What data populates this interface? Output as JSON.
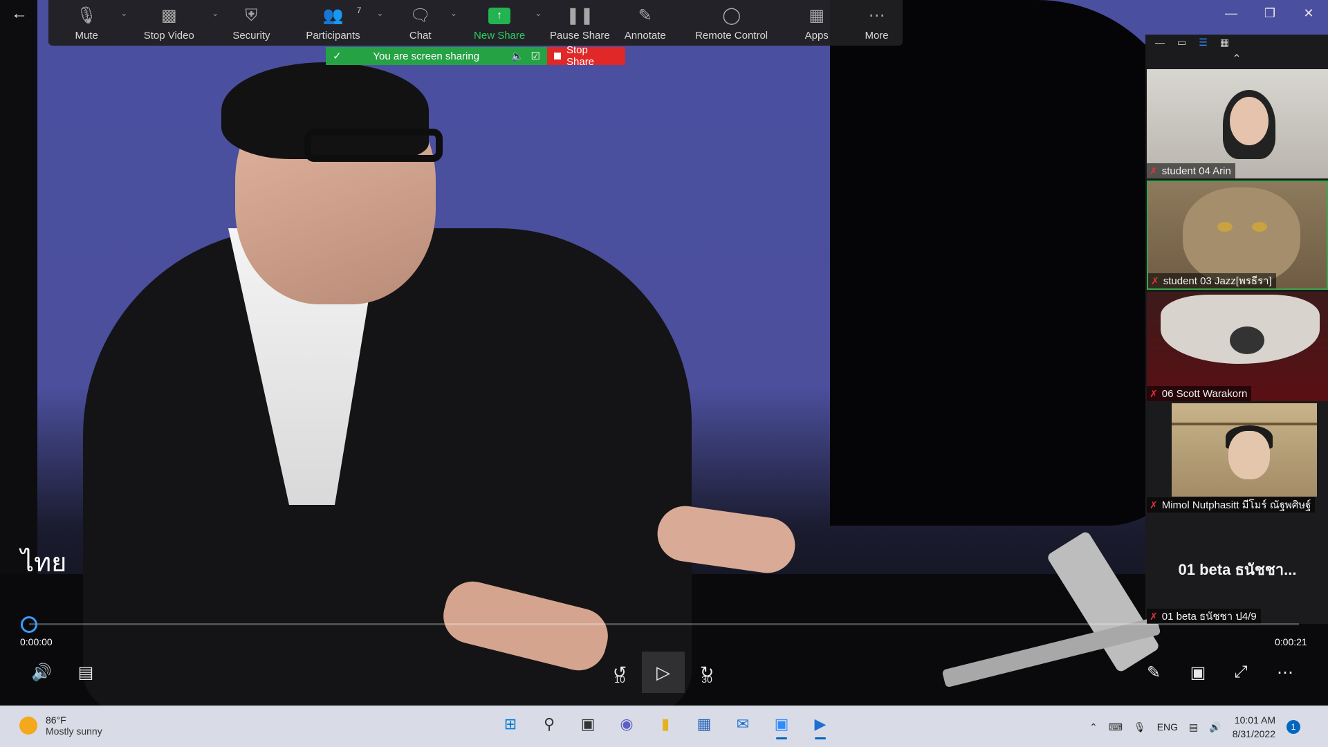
{
  "zoom_toolbar": {
    "items": [
      {
        "label": "Mute",
        "icon": "microphone-icon"
      },
      {
        "label": "Stop Video",
        "icon": "video-camera-icon"
      },
      {
        "label": "Security",
        "icon": "shield-icon"
      },
      {
        "label": "Participants",
        "icon": "participants-icon",
        "count": "7"
      },
      {
        "label": "Chat",
        "icon": "chat-icon"
      },
      {
        "label": "New Share",
        "icon": "share-screen-icon"
      },
      {
        "label": "Pause Share",
        "icon": "pause-icon"
      },
      {
        "label": "Annotate",
        "icon": "pen-icon"
      },
      {
        "label": "Remote Control",
        "icon": "mouse-icon"
      },
      {
        "label": "Apps",
        "icon": "apps-icon"
      },
      {
        "label": "More",
        "icon": "more-icon"
      }
    ]
  },
  "share_banner": {
    "status": "You are screen sharing",
    "stop_label": "Stop Share"
  },
  "gallery": {
    "participants": [
      {
        "name": "student 04 Arin"
      },
      {
        "name": "student 03 Jazz[พรธีรา]"
      },
      {
        "name": "06 Scott Warakorn"
      },
      {
        "name": "Mimol Nutphasitt มีโมร์ ณัฐพศิษฐ์"
      },
      {
        "name": "01 beta ธนัชชา ป4/9",
        "display_name": "01 beta ธนัชชา..."
      }
    ]
  },
  "player": {
    "subtitle_language": "ไทย",
    "time_current": "0:00:00",
    "time_total": "0:00:21",
    "skip_back": "10",
    "skip_forward": "30",
    "progress_fraction": 0
  },
  "taskbar": {
    "weather_temp": "86°F",
    "weather_desc": "Mostly sunny",
    "language": "ENG",
    "time": "10:01 AM",
    "date": "8/31/2022",
    "notifications": "1"
  },
  "colors": {
    "share_green": "#25a244",
    "stop_red": "#e02828",
    "accent_blue": "#2d8cff"
  }
}
